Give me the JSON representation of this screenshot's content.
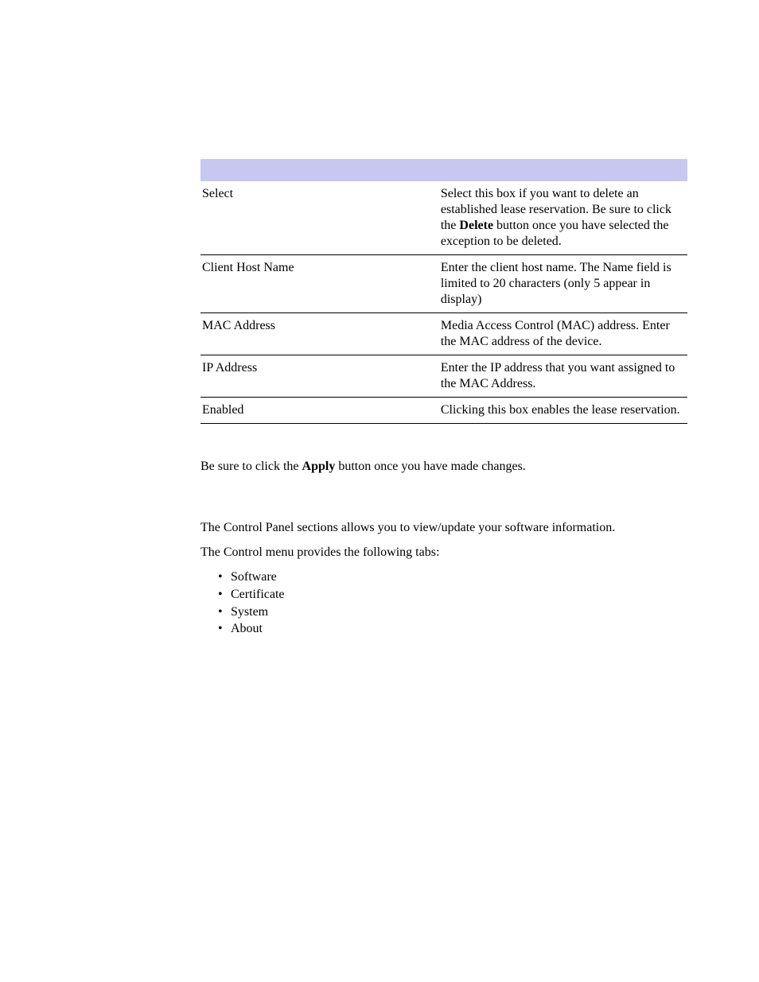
{
  "table": {
    "rows": [
      {
        "label": "Select",
        "desc_pre": "Select this box if you want to delete an established lease reservation. Be sure to click the ",
        "desc_bold": "Delete",
        "desc_post": " button once you have selected the exception to be deleted."
      },
      {
        "label": "Client Host Name",
        "desc_pre": "Enter the client host name. The Name field is limited to 20 characters (only 5 appear in display)",
        "desc_bold": "",
        "desc_post": ""
      },
      {
        "label": "MAC Address",
        "desc_pre": "Media Access Control (MAC) address. Enter the MAC address of the device.",
        "desc_bold": "",
        "desc_post": ""
      },
      {
        "label": "IP Address",
        "desc_pre": "Enter the IP address that you want assigned to the MAC Address.",
        "desc_bold": "",
        "desc_post": ""
      },
      {
        "label": "Enabled",
        "desc_pre": "Clicking this box enables the lease reservation.",
        "desc_bold": "",
        "desc_post": ""
      }
    ]
  },
  "note": {
    "pre": "Be sure to click the ",
    "bold": "Apply",
    "post": " button once you have made changes."
  },
  "section2": {
    "p1": "The Control Panel sections allows you to view/update your software information.",
    "p2": "The Control menu provides the following tabs:",
    "tabs": [
      "Software",
      "Certificate",
      "System",
      "About"
    ]
  }
}
